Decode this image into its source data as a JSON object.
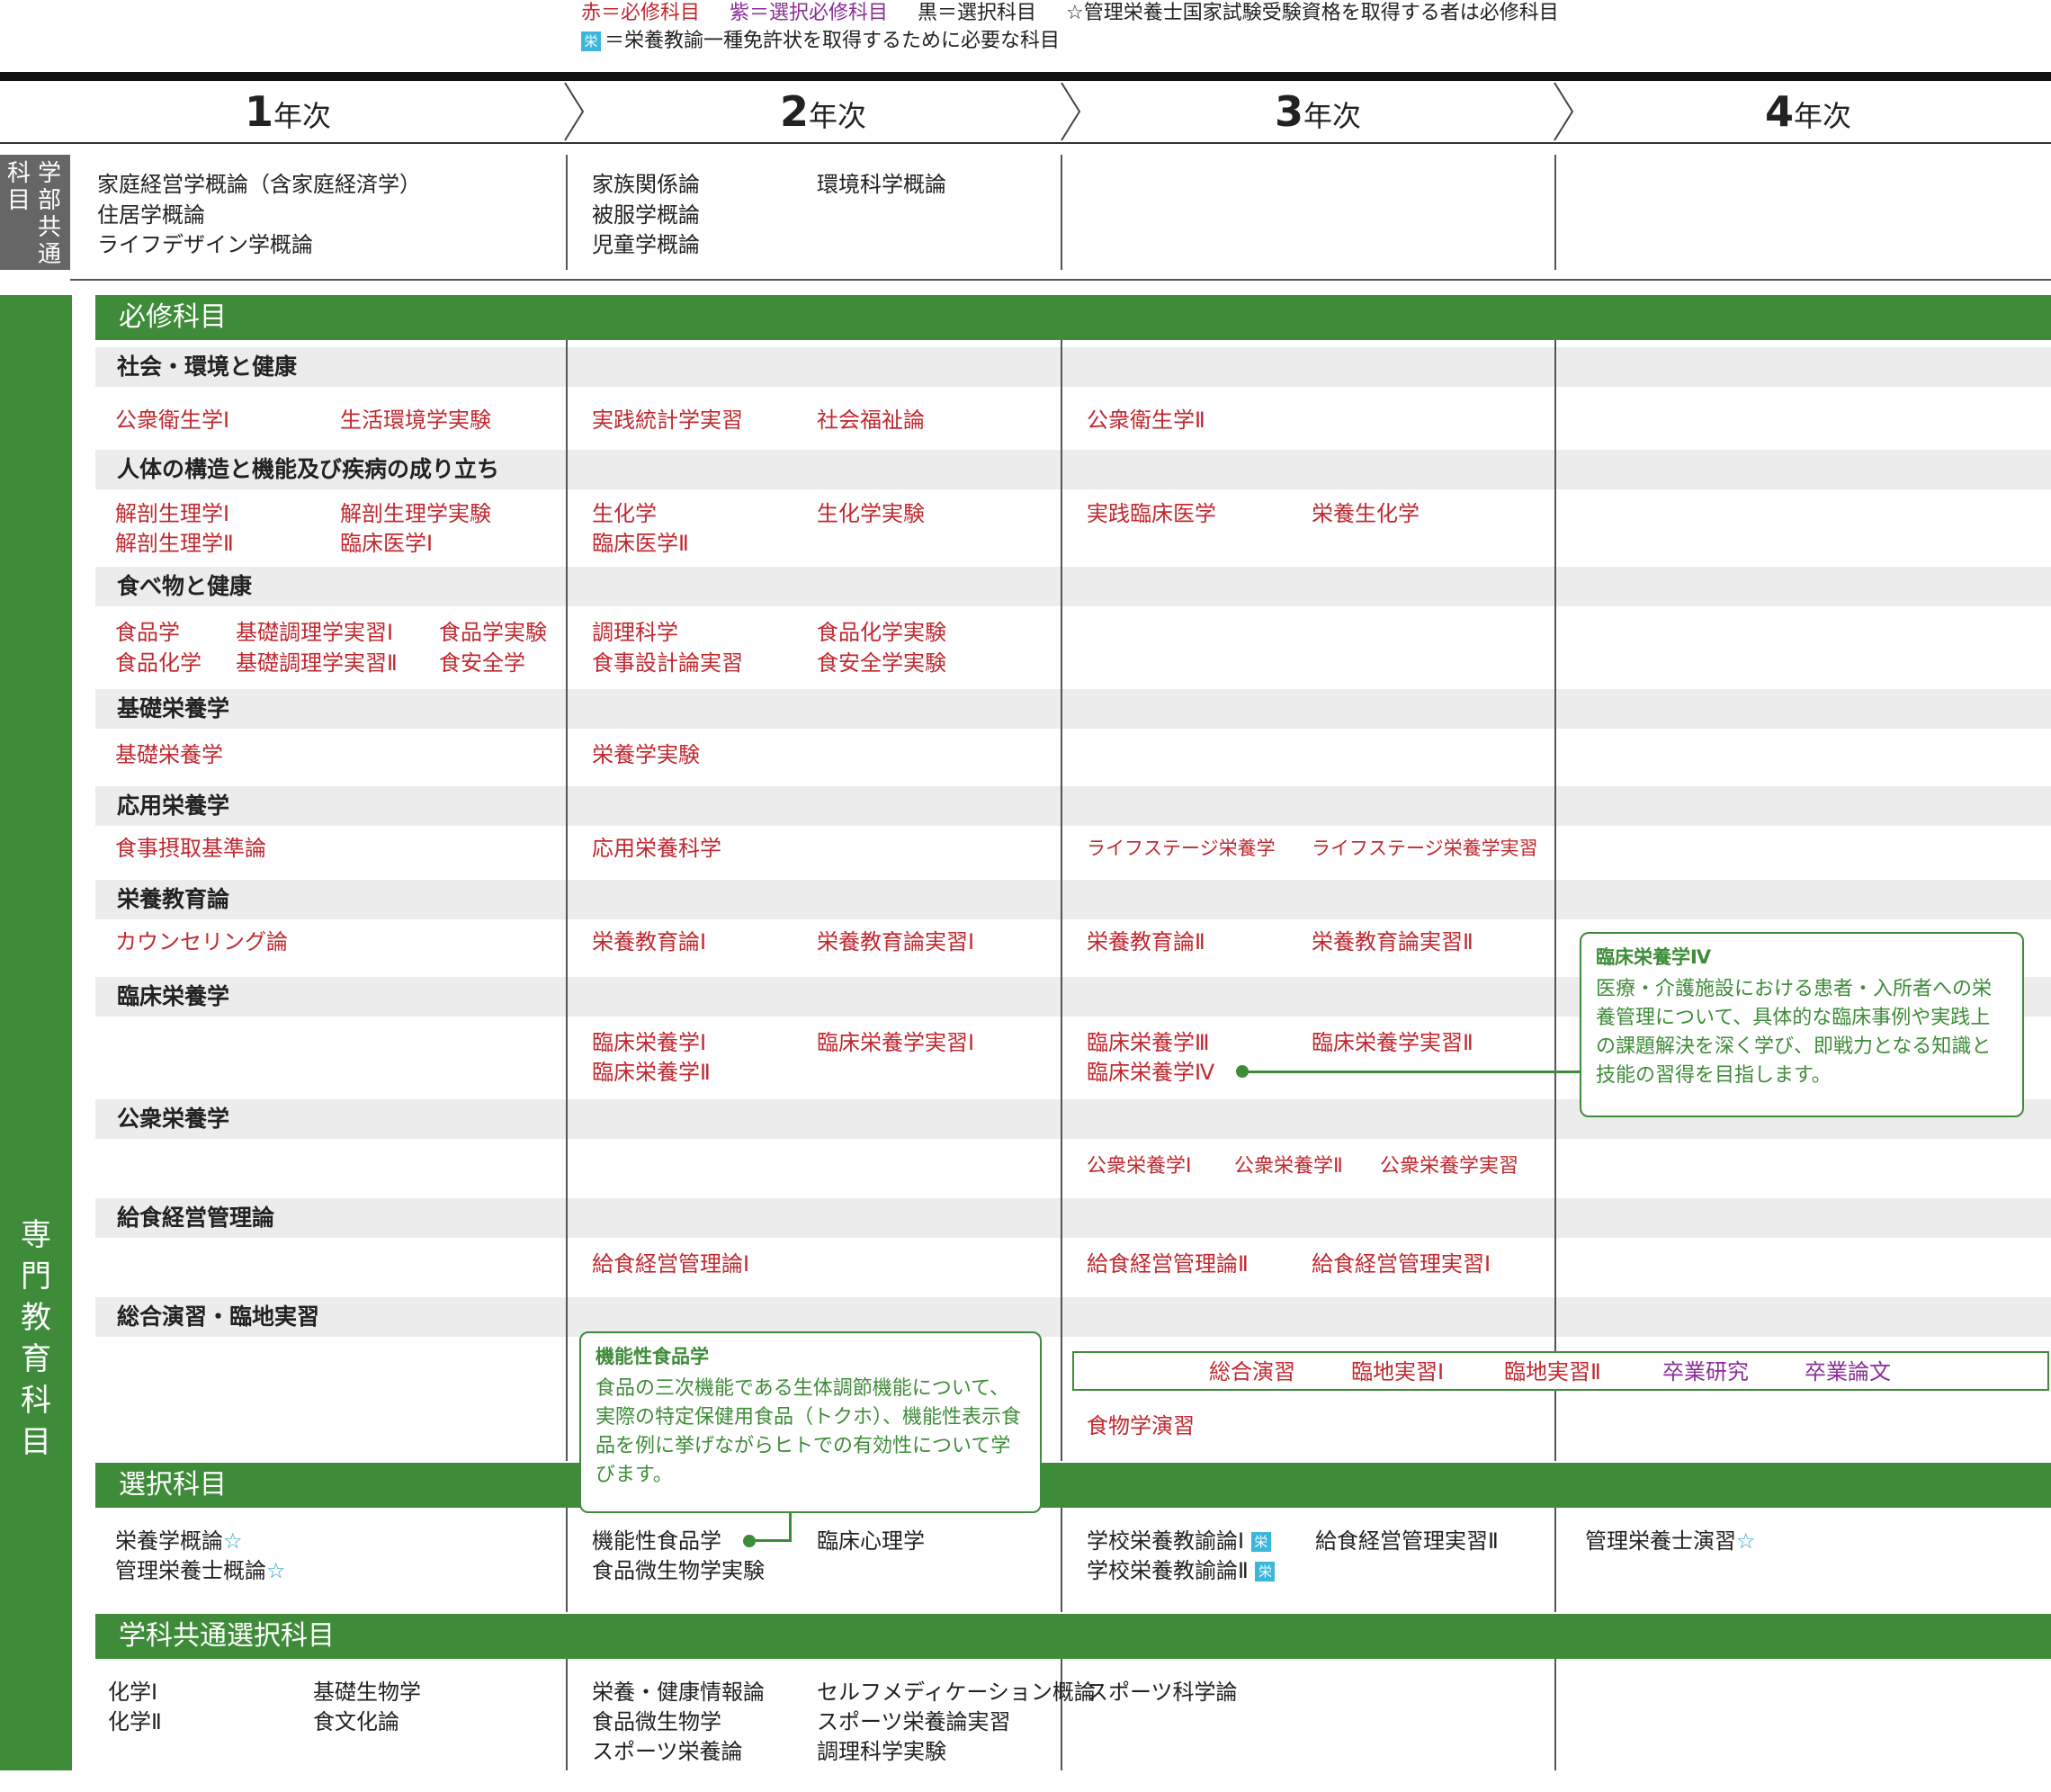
{
  "legend": {
    "red": "赤＝必修科目",
    "purple": "紫＝選択必修科目",
    "black": "黒＝選択科目",
    "star_text": "☆管理栄養士国家試験受験資格を取得する者は必修科目",
    "ei_icon": "栄",
    "ei_text": "＝栄養教諭一種免許状を取得するために必要な科目"
  },
  "years": [
    {
      "num": "1",
      "label": "年次"
    },
    {
      "num": "2",
      "label": "年次"
    },
    {
      "num": "3",
      "label": "年次"
    },
    {
      "num": "4",
      "label": "年次"
    }
  ],
  "common": {
    "side_label": "学部共通科目",
    "y1": [
      "家庭経営学概論（含家庭経済学）",
      "住居学概論",
      "ライフデザイン学概論"
    ],
    "y2a": [
      "家族関係論",
      "被服学概論",
      "児童学概論"
    ],
    "y2b": [
      "環境科学概論"
    ]
  },
  "specialty": {
    "side_label": "専門教育科目",
    "required_band": "必修科目",
    "elective_band": "選択科目",
    "dept_band": "学科共通選択科目"
  },
  "categories": [
    "社会・環境と健康",
    "人体の構造と機能及び疾病の成り立ち",
    "食べ物と健康",
    "基礎栄養学",
    "応用栄養学",
    "栄養教育論",
    "臨床栄養学",
    "公衆栄養学",
    "給食経営管理論",
    "総合演習・臨地実習"
  ],
  "subjects": {
    "c0": [
      "公衆衛生学Ⅰ",
      "生活環境学実験",
      "実践統計学実習",
      "社会福祉論",
      "公衆衛生学Ⅱ"
    ],
    "c1": [
      "解剖生理学Ⅰ",
      "解剖生理学実験",
      "解剖生理学Ⅱ",
      "臨床医学Ⅰ",
      "生化学",
      "生化学実験",
      "臨床医学Ⅱ",
      "実践臨床医学",
      "栄養生化学"
    ],
    "c2": [
      "食品学",
      "基礎調理学実習Ⅰ",
      "食品学実験",
      "食品化学",
      "基礎調理学実習Ⅱ",
      "食安全学",
      "調理科学",
      "食品化学実験",
      "食事設計論実習",
      "食安全学実験"
    ],
    "c3": [
      "基礎栄養学",
      "栄養学実験"
    ],
    "c4": [
      "食事摂取基準論",
      "応用栄養科学",
      "ライフステージ栄養学",
      "ライフステージ栄養学実習"
    ],
    "c5": [
      "カウンセリング論",
      "栄養教育論Ⅰ",
      "栄養教育論実習Ⅰ",
      "栄養教育論Ⅱ",
      "栄養教育論実習Ⅱ"
    ],
    "c6": [
      "臨床栄養学Ⅰ",
      "臨床栄養学実習Ⅰ",
      "臨床栄養学Ⅱ",
      "臨床栄養学Ⅲ",
      "臨床栄養学実習Ⅱ",
      "臨床栄養学Ⅳ"
    ],
    "c7": [
      "公衆栄養学Ⅰ",
      "公衆栄養学Ⅱ",
      "公衆栄養学実習"
    ],
    "c8": [
      "給食経営管理論Ⅰ",
      "給食経営管理論Ⅱ",
      "給食経営管理実習Ⅰ"
    ],
    "c9": [
      "総合演習",
      "臨地実習Ⅰ",
      "臨地実習Ⅱ",
      "卒業研究",
      "卒業論文",
      "食物学演習"
    ]
  },
  "electives": {
    "y1": [
      "栄養学概論",
      "管理栄養士概論"
    ],
    "y2": [
      "機能性食品学",
      "臨床心理学",
      "食品微生物学実験"
    ],
    "y3": [
      "学校栄養教諭論Ⅰ",
      "給食経営管理実習Ⅱ",
      "学校栄養教諭論Ⅱ"
    ],
    "y4": [
      "管理栄養士演習"
    ],
    "star": "☆",
    "ei": "栄"
  },
  "dept": {
    "y1": [
      "化学Ⅰ",
      "基礎生物学",
      "化学Ⅱ",
      "食文化論"
    ],
    "y2": [
      "栄養・健康情報論",
      "セルフメディケーション概論",
      "食品微生物学",
      "スポーツ栄養論実習",
      "スポーツ栄養論",
      "調理科学実験"
    ],
    "y3": [
      "スポーツ科学論"
    ]
  },
  "callouts": {
    "clinical": {
      "title": "臨床栄養学Ⅳ",
      "body": "医療・介護施設における患者・入所者への栄養管理について、具体的な臨床事例や実践上の課題解決を深く学び、即戦力となる知識と技能の習得を目指します。"
    },
    "functional": {
      "title": "機能性食品学",
      "body": "食品の三次機能である生体調節機能について、実際の特定保健用食品（トクホ）、機能性表示食品を例に挙げながらヒトでの有効性について学びます。"
    }
  },
  "colors": {
    "red": "#c0292f",
    "purple": "#8a2e96",
    "green": "#3e8c39",
    "cyan": "#3cb6d9",
    "star": "#2ba3c8"
  }
}
